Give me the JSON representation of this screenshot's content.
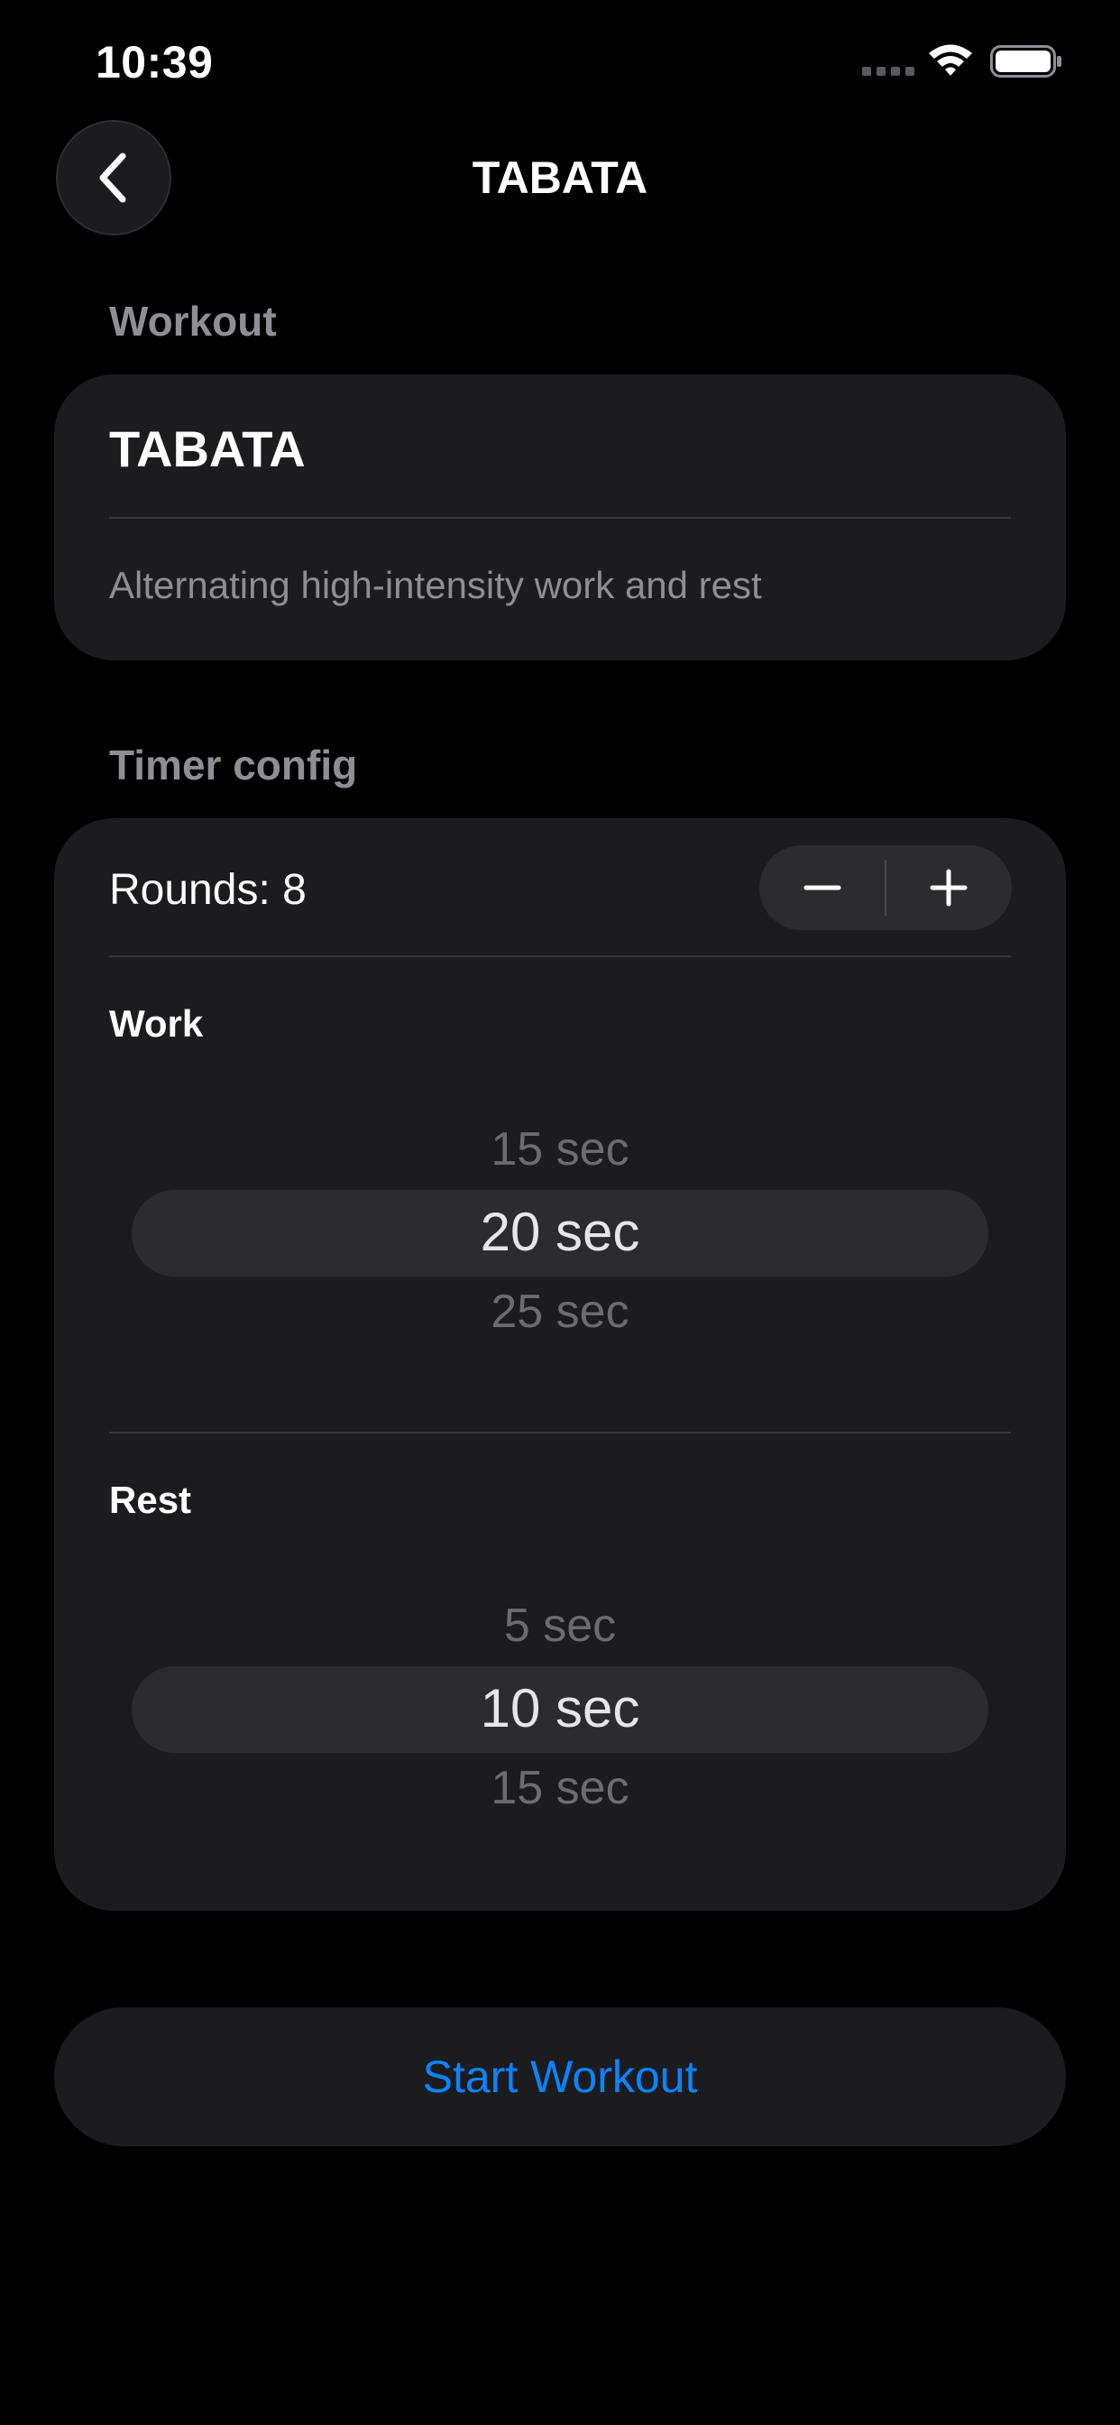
{
  "status_bar": {
    "time": "10:39"
  },
  "nav": {
    "title": "TABATA"
  },
  "workout_section": {
    "label": "Workout",
    "name": "TABATA",
    "description": "Alternating high-intensity work and rest"
  },
  "timer_section": {
    "label": "Timer config",
    "rounds_label": "Rounds: 8",
    "work": {
      "label": "Work",
      "prev": "15 sec",
      "selected": "20 sec",
      "next": "25 sec"
    },
    "rest": {
      "label": "Rest",
      "prev": "5 sec",
      "selected": "10 sec",
      "next": "15 sec"
    }
  },
  "start_button": {
    "label": "Start Workout"
  },
  "colors": {
    "background": "#000000",
    "card": "#1c1c1e",
    "accent": "#0a84ff",
    "secondary_text": "#8e8e93"
  }
}
